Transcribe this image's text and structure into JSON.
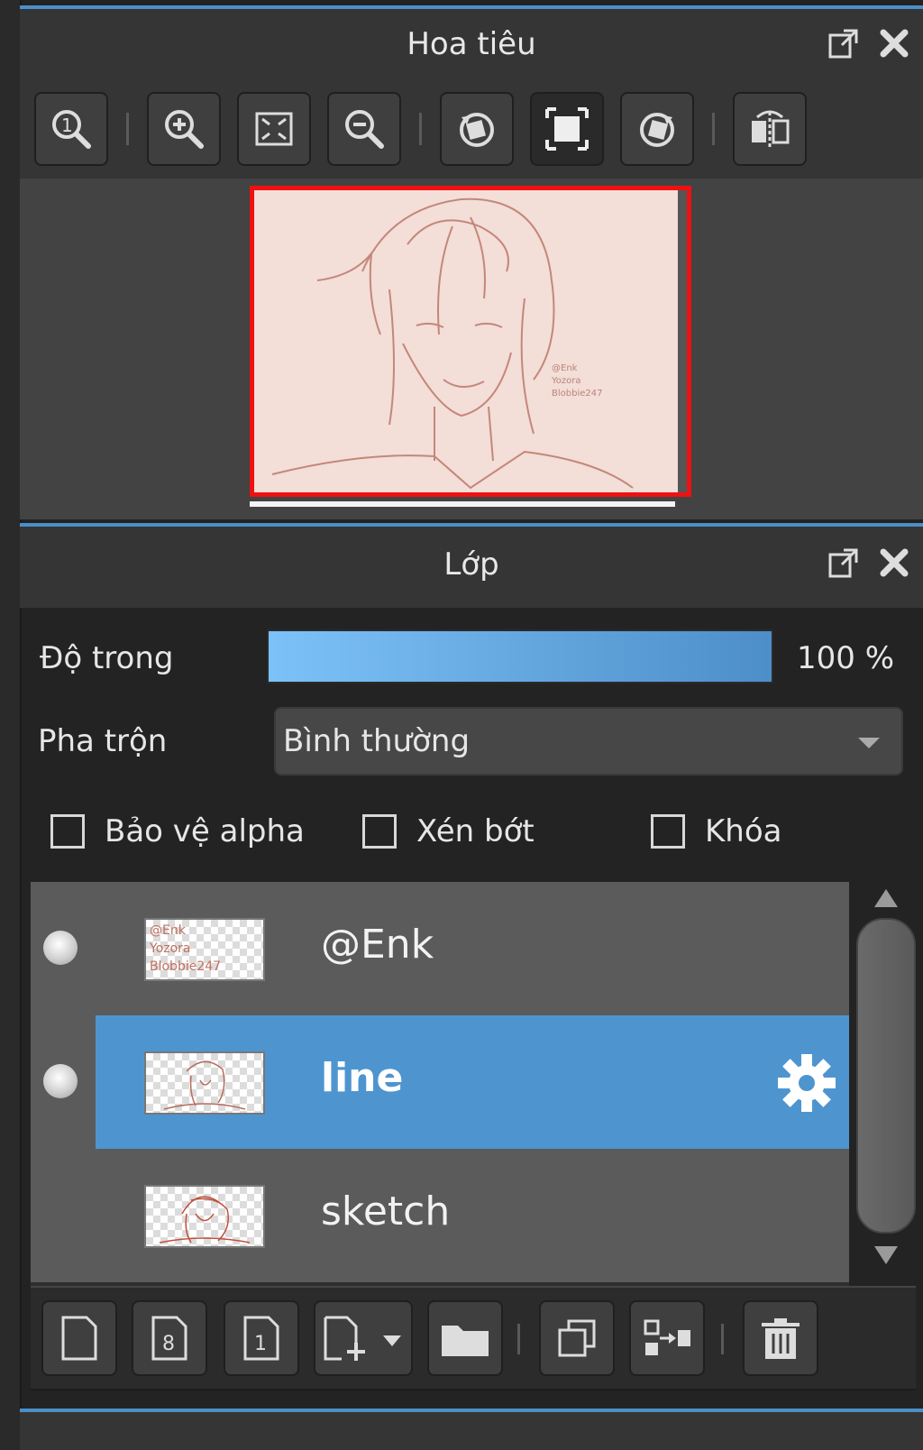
{
  "navigator": {
    "title": "Hoa tiêu",
    "toolbar_icons": [
      "zoom-actual-icon",
      "zoom-in-icon",
      "fit-screen-icon",
      "zoom-out-icon",
      "rotate-left-icon",
      "fit-window-icon",
      "rotate-right-icon",
      "flip-icon"
    ],
    "preview_watermark": [
      "@Enk",
      "Yozora",
      "Blobbie247"
    ]
  },
  "layers_panel": {
    "title": "Lớp",
    "opacity_label": "Độ trong",
    "opacity_value": "100 %",
    "opacity_fraction": 1.0,
    "blend_label": "Pha trộn",
    "blend_value": "Bình thường",
    "checkboxes": {
      "protect_alpha": "Bảo vệ alpha",
      "clipping": "Xén bớt",
      "lock": "Khóa"
    },
    "layers": [
      {
        "name": "@Enk",
        "visible": true,
        "selected": false
      },
      {
        "name": "line",
        "visible": true,
        "selected": true
      },
      {
        "name": "sketch",
        "visible": false,
        "selected": false
      }
    ],
    "bottom_icons": [
      "new-layer-icon",
      "new-8bit-layer-icon",
      "new-1bit-layer-icon",
      "add-layer-dropdown-icon",
      "new-folder-icon",
      "duplicate-layer-icon",
      "merge-down-icon",
      "delete-icon"
    ]
  },
  "colors": {
    "accent": "#4e95d0",
    "panel": "#353535",
    "selection_border": "#ee1111"
  }
}
